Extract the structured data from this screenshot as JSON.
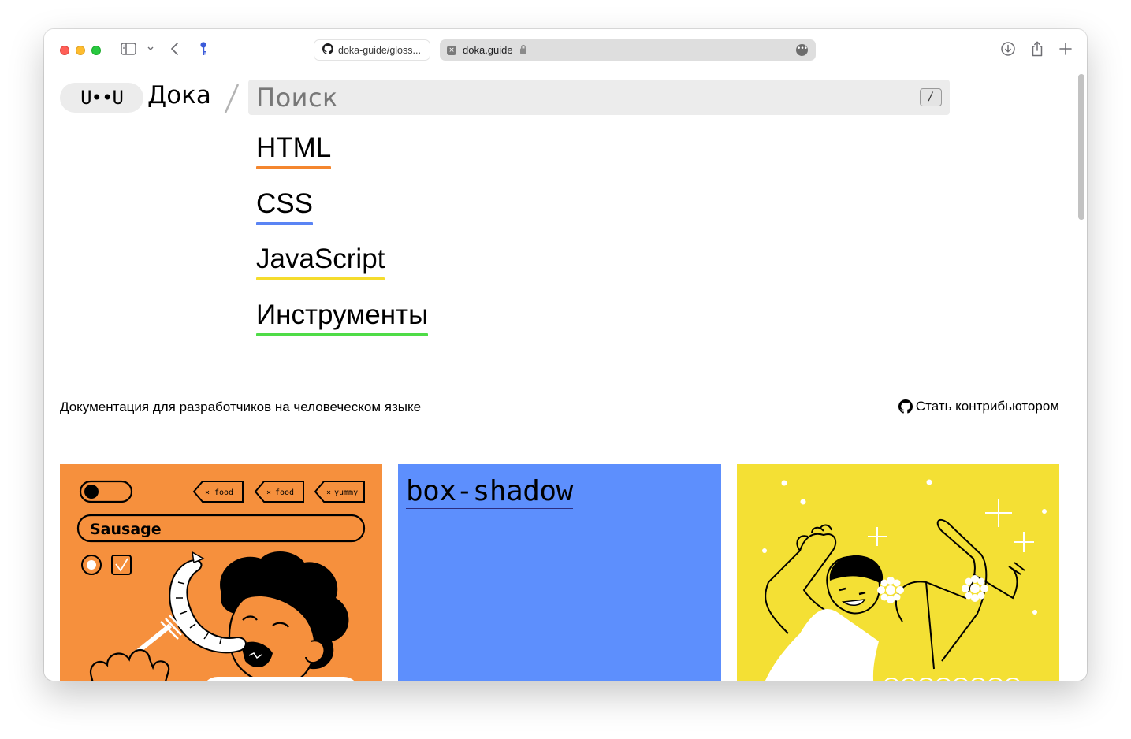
{
  "browser": {
    "tabs": [
      {
        "title": "doka-guide/gloss...",
        "icon": "github-icon"
      },
      {
        "title": "doka.guide",
        "icon": "close-icon",
        "active": true
      }
    ]
  },
  "header": {
    "logo_mark": "U••U",
    "logo_text": "Дока",
    "search_placeholder": "Поиск",
    "search_shortcut": "/"
  },
  "nav": {
    "items": [
      {
        "label": "HTML",
        "color": "#f4862e"
      },
      {
        "label": "CSS",
        "color": "#5a84f4"
      },
      {
        "label": "JavaScript",
        "color": "#f5dc2d"
      },
      {
        "label": "Инструменты",
        "color": "#4fdc47"
      }
    ]
  },
  "tagline": "Документация для разработчиков на человеческом языке",
  "contribute_link": "Стать контрибьютором",
  "cards": [
    {
      "color": "#f6903d",
      "illustration": {
        "tags": [
          "food",
          "food",
          "yummy"
        ],
        "input_value": "Sausage"
      }
    },
    {
      "color": "#5d8ffd",
      "title": "box-shadow"
    },
    {
      "color": "#f4e034"
    }
  ]
}
